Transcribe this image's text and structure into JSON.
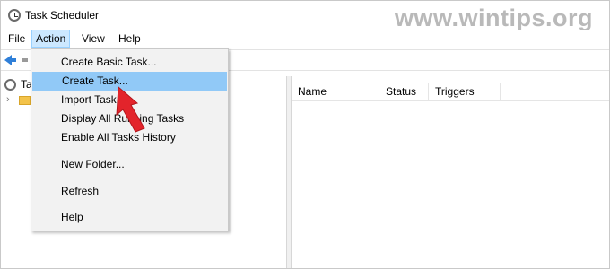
{
  "window": {
    "title": "Task Scheduler",
    "watermark": "www.wintips.org"
  },
  "menubar": {
    "items": [
      "File",
      "Action",
      "View",
      "Help"
    ],
    "active": "Action"
  },
  "tree": {
    "root_label": "Ta"
  },
  "list": {
    "columns": [
      "Name",
      "Status",
      "Triggers"
    ]
  },
  "menu": {
    "items": [
      {
        "label": "Create Basic Task..."
      },
      {
        "label": "Create Task..."
      },
      {
        "label": "Import Task..."
      },
      {
        "label": "Display All Running Tasks"
      },
      {
        "label": "Enable All Tasks History"
      },
      {
        "label": "New Folder..."
      },
      {
        "label": "Refresh"
      },
      {
        "label": "Help"
      }
    ],
    "highlighted": "Create Task..."
  },
  "colors": {
    "highlight": "#91c9f7",
    "arrow": "#e3242b",
    "accent": "#2f7fd8"
  },
  "icons": [
    "clock-icon",
    "back-arrow-icon",
    "folder-icon",
    "pointer-arrow-icon"
  ]
}
